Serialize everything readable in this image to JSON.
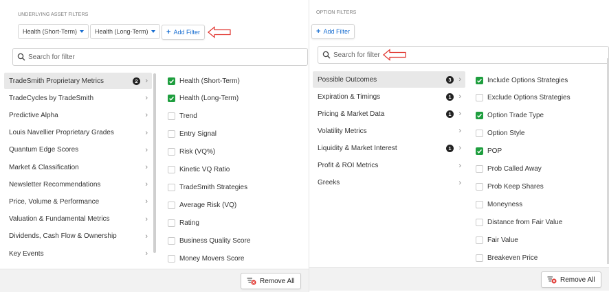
{
  "underlying": {
    "title": "UNDERLYING ASSET FILTERS",
    "chips": [
      {
        "label": "Health (Short-Term)"
      },
      {
        "label": "Health (Long-Term)"
      }
    ],
    "add_label": "Add Filter",
    "search_placeholder": "Search for filter",
    "categories": [
      {
        "label": "TradeSmith Proprietary Metrics",
        "badge": "2",
        "active": true
      },
      {
        "label": "TradeCycles by TradeSmith"
      },
      {
        "label": "Predictive Alpha"
      },
      {
        "label": "Louis Navellier Proprietary Grades"
      },
      {
        "label": "Quantum Edge Scores"
      },
      {
        "label": "Market & Classification"
      },
      {
        "label": "Newsletter Recommendations"
      },
      {
        "label": "Price, Volume & Performance"
      },
      {
        "label": "Valuation & Fundamental Metrics"
      },
      {
        "label": "Dividends, Cash Flow & Ownership"
      },
      {
        "label": "Key Events"
      }
    ],
    "options": [
      {
        "label": "Health (Short-Term)",
        "checked": true
      },
      {
        "label": "Health (Long-Term)",
        "checked": true
      },
      {
        "label": "Trend",
        "checked": false
      },
      {
        "label": "Entry Signal",
        "checked": false
      },
      {
        "label": "Risk (VQ%)",
        "checked": false
      },
      {
        "label": "Kinetic VQ Ratio",
        "checked": false
      },
      {
        "label": "TradeSmith Strategies",
        "checked": false
      },
      {
        "label": "Average Risk (VQ)",
        "checked": false
      },
      {
        "label": "Rating",
        "checked": false
      },
      {
        "label": "Business Quality Score",
        "checked": false
      },
      {
        "label": "Money Movers Score",
        "checked": false
      }
    ],
    "remove_label": "Remove All"
  },
  "option_filters": {
    "title": "OPTION FILTERS",
    "add_label": "Add Filter",
    "search_placeholder": "Search for filter",
    "categories": [
      {
        "label": "Possible Outcomes",
        "badge": "3",
        "active": true
      },
      {
        "label": "Expiration & Timings",
        "badge": "1"
      },
      {
        "label": "Pricing & Market Data",
        "badge": "1"
      },
      {
        "label": "Volatility Metrics"
      },
      {
        "label": "Liquidity & Market Interest",
        "badge": "1"
      },
      {
        "label": "Profit & ROI Metrics"
      },
      {
        "label": "Greeks"
      }
    ],
    "options": [
      {
        "label": "Include Options Strategies",
        "checked": true
      },
      {
        "label": "Exclude Options Strategies",
        "checked": false
      },
      {
        "label": "Option Trade Type",
        "checked": true
      },
      {
        "label": "Option Style",
        "checked": false
      },
      {
        "label": "POP",
        "checked": true
      },
      {
        "label": "Prob Called Away",
        "checked": false
      },
      {
        "label": "Prob Keep Shares",
        "checked": false
      },
      {
        "label": "Moneyness",
        "checked": false
      },
      {
        "label": "Distance from Fair Value",
        "checked": false
      },
      {
        "label": "Fair Value",
        "checked": false
      },
      {
        "label": "Breakeven Price",
        "checked": false
      }
    ],
    "remove_label": "Remove All"
  },
  "colors": {
    "accent": "#1a6fd1",
    "check": "#1e9e3e",
    "annotation": "#e0312b"
  }
}
